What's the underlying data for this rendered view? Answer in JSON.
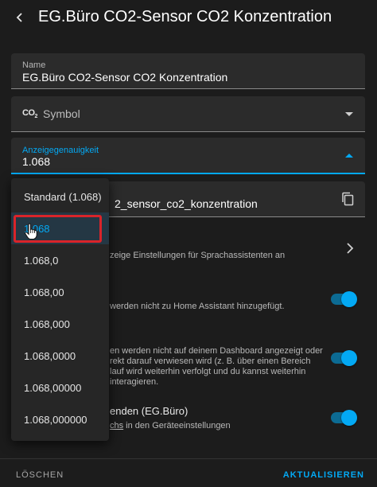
{
  "header": {
    "title": "EG.Büro CO2-Sensor CO2 Konzentration"
  },
  "name_field": {
    "label": "Name",
    "value": "EG.Büro CO2-Sensor CO2 Konzentration"
  },
  "icon_field": {
    "icon_text": "CO",
    "icon_sub": "2",
    "value": "Symbol"
  },
  "precision_field": {
    "label": "Anzeigegenauigkeit",
    "value": "1.068"
  },
  "entity_field": {
    "value": "2_sensor_co2_konzentration"
  },
  "voice_row": {
    "text": "zeige Einstellungen für Sprachassistenten an"
  },
  "enabled_row": {
    "text": "werden nicht zu Home Assistant hinzugefügt."
  },
  "visible_row": {
    "lines": [
      "en werden nicht auf deinem Dashboard angezeigt oder",
      "rekt darauf verwiesen wird (z. B. über einen Bereich",
      "lauf wird weiterhin verfolgt und du kannst weiterhin",
      "interagieren."
    ]
  },
  "area_row": {
    "title": "enden (EG.Büro)",
    "text_link": "chs",
    "text_rest": " in den Geräteeinstellungen"
  },
  "footer": {
    "delete": "LÖSCHEN",
    "update": "AKTUALISIEREN"
  },
  "dropdown": {
    "options": [
      "Standard (1.068)",
      "1.068",
      "1.068,0",
      "1.068,00",
      "1.068,000",
      "1.068,0000",
      "1.068,00000",
      "1.068,000000"
    ],
    "selected_index": 1
  },
  "colors": {
    "accent": "#03a9f4",
    "background": "#1c1c1c",
    "highlight": "#d9242a"
  }
}
